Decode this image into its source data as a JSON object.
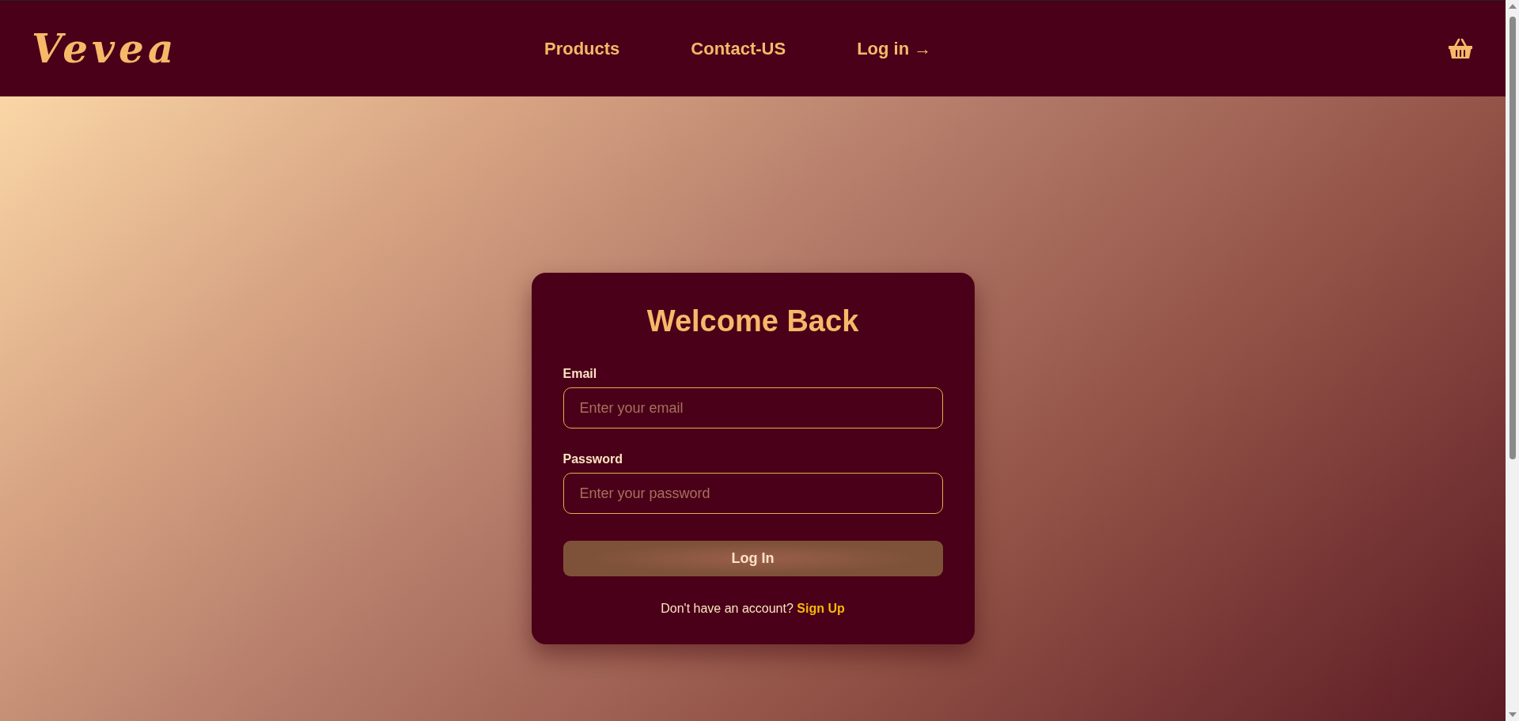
{
  "header": {
    "logo": "Vevea",
    "nav": [
      {
        "label": "Products"
      },
      {
        "label": "Contact-US"
      },
      {
        "label": "Log in →"
      }
    ]
  },
  "login_card": {
    "title": "Welcome Back",
    "fields": [
      {
        "label": "Email",
        "placeholder": "Enter your email"
      },
      {
        "label": "Password",
        "placeholder": "Enter your password"
      }
    ],
    "button": "Log In",
    "footer": {
      "text": "Don't have an account?",
      "link": "Sign Up"
    }
  }
}
